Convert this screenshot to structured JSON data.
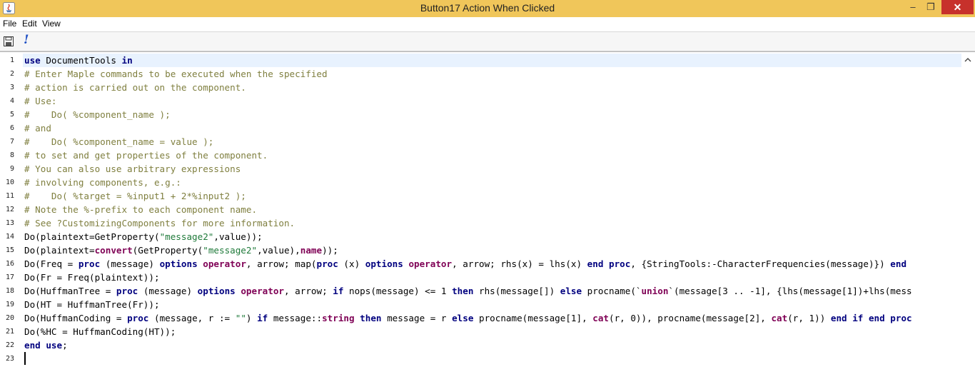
{
  "window": {
    "title": "Button17 Action When Clicked",
    "minimize": "–",
    "maximize": "❐",
    "close": "✕"
  },
  "menu": [
    "File",
    "Edit",
    "View"
  ],
  "toolbar": {
    "execute_label": "!"
  },
  "editor": {
    "line_numbers": [
      "1",
      "2",
      "3",
      "4",
      "5",
      "6",
      "7",
      "8",
      "9",
      "10",
      "11",
      "12",
      "13",
      "14",
      "15",
      "16",
      "17",
      "18",
      "19",
      "20",
      "21",
      "22",
      "23"
    ],
    "lines": [
      [
        {
          "t": "use",
          "c": "kw"
        },
        {
          "t": " DocumentTools ",
          "c": ""
        },
        {
          "t": "in",
          "c": "kw"
        }
      ],
      [
        {
          "t": "# Enter Maple commands to be executed when the specified",
          "c": "cm"
        }
      ],
      [
        {
          "t": "# action is carried out on the component.",
          "c": "cm"
        }
      ],
      [
        {
          "t": "# Use:",
          "c": "cm"
        }
      ],
      [
        {
          "t": "#    Do( %component_name );",
          "c": "cm"
        }
      ],
      [
        {
          "t": "# and",
          "c": "cm"
        }
      ],
      [
        {
          "t": "#    Do( %component_name = value );",
          "c": "cm"
        }
      ],
      [
        {
          "t": "# to set and get properties of the component.",
          "c": "cm"
        }
      ],
      [
        {
          "t": "# You can also use arbitrary expressions",
          "c": "cm"
        }
      ],
      [
        {
          "t": "# involving components, e.g.:",
          "c": "cm"
        }
      ],
      [
        {
          "t": "#    Do( %target = %input1 + 2*%input2 );",
          "c": "cm"
        }
      ],
      [
        {
          "t": "# Note the %-prefix to each component name.",
          "c": "cm"
        }
      ],
      [
        {
          "t": "# See ?CustomizingComponents for more information.",
          "c": "cm"
        }
      ],
      [
        {
          "t": "Do(plaintext=GetProperty(",
          "c": ""
        },
        {
          "t": "\"message2\"",
          "c": "st"
        },
        {
          "t": ",value));",
          "c": ""
        }
      ],
      [
        {
          "t": "Do(plaintext=",
          "c": ""
        },
        {
          "t": "convert",
          "c": "id"
        },
        {
          "t": "(GetProperty(",
          "c": ""
        },
        {
          "t": "\"message2\"",
          "c": "st"
        },
        {
          "t": ",value),",
          "c": ""
        },
        {
          "t": "name",
          "c": "id"
        },
        {
          "t": "));",
          "c": ""
        }
      ],
      [
        {
          "t": "Do(Freq = ",
          "c": ""
        },
        {
          "t": "proc",
          "c": "kw"
        },
        {
          "t": " (message) ",
          "c": ""
        },
        {
          "t": "options",
          "c": "kw"
        },
        {
          "t": " ",
          "c": ""
        },
        {
          "t": "operator",
          "c": "id"
        },
        {
          "t": ", arrow; map(",
          "c": ""
        },
        {
          "t": "proc",
          "c": "kw"
        },
        {
          "t": " (x) ",
          "c": ""
        },
        {
          "t": "options",
          "c": "kw"
        },
        {
          "t": " ",
          "c": ""
        },
        {
          "t": "operator",
          "c": "id"
        },
        {
          "t": ", arrow; rhs(x) = lhs(x) ",
          "c": ""
        },
        {
          "t": "end proc",
          "c": "kw"
        },
        {
          "t": ", {StringTools:-CharacterFrequencies(message)}) ",
          "c": ""
        },
        {
          "t": "end",
          "c": "kw"
        }
      ],
      [
        {
          "t": "Do(Fr = Freq(plaintext));",
          "c": ""
        }
      ],
      [
        {
          "t": "Do(HuffmanTree = ",
          "c": ""
        },
        {
          "t": "proc",
          "c": "kw"
        },
        {
          "t": " (message) ",
          "c": ""
        },
        {
          "t": "options",
          "c": "kw"
        },
        {
          "t": " ",
          "c": ""
        },
        {
          "t": "operator",
          "c": "id"
        },
        {
          "t": ", arrow; ",
          "c": ""
        },
        {
          "t": "if",
          "c": "kw"
        },
        {
          "t": " nops(message) <= 1 ",
          "c": ""
        },
        {
          "t": "then",
          "c": "kw"
        },
        {
          "t": " rhs(message[]) ",
          "c": ""
        },
        {
          "t": "else",
          "c": "kw"
        },
        {
          "t": " procname(`",
          "c": ""
        },
        {
          "t": "union",
          "c": "id"
        },
        {
          "t": "`(message[3 .. -1], {lhs(message[1])+lhs(mess",
          "c": ""
        }
      ],
      [
        {
          "t": "Do(HT = HuffmanTree(Fr));",
          "c": ""
        }
      ],
      [
        {
          "t": "Do(HuffmanCoding = ",
          "c": ""
        },
        {
          "t": "proc",
          "c": "kw"
        },
        {
          "t": " (message, r := ",
          "c": ""
        },
        {
          "t": "\"\"",
          "c": "st"
        },
        {
          "t": ") ",
          "c": ""
        },
        {
          "t": "if",
          "c": "kw"
        },
        {
          "t": " message::",
          "c": ""
        },
        {
          "t": "string",
          "c": "id"
        },
        {
          "t": " ",
          "c": ""
        },
        {
          "t": "then",
          "c": "kw"
        },
        {
          "t": " message = r ",
          "c": ""
        },
        {
          "t": "else",
          "c": "kw"
        },
        {
          "t": " procname(message[1], ",
          "c": ""
        },
        {
          "t": "cat",
          "c": "id"
        },
        {
          "t": "(r, 0)), procname(message[2], ",
          "c": ""
        },
        {
          "t": "cat",
          "c": "id"
        },
        {
          "t": "(r, 1)) ",
          "c": ""
        },
        {
          "t": "end if end proc",
          "c": "kw"
        }
      ],
      [
        {
          "t": "Do(%HC = HuffmanCoding(HT));",
          "c": ""
        }
      ],
      [
        {
          "t": "end use",
          "c": "kw"
        },
        {
          "t": ";",
          "c": ""
        }
      ],
      []
    ]
  }
}
